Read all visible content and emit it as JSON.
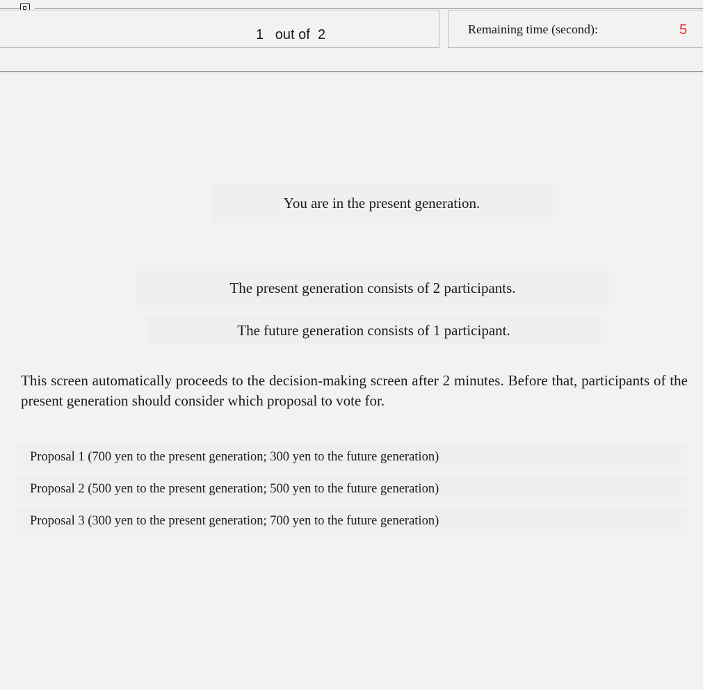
{
  "header": {
    "round": {
      "current": "1",
      "separator": "out of",
      "total": "2"
    },
    "timer": {
      "label": "Remaining time (second):",
      "value": "5",
      "value_color": "#ee2a2a"
    }
  },
  "main": {
    "generation_label": "You are in the present generation.",
    "present_generation_label": "The present generation consists of 2 participants.",
    "future_generation_label": "The future generation consists of 1 participant.",
    "instructions": "This screen automatically proceeds to the decision-making screen after 2 minutes. Before that, participants of the present generation should consider which proposal to vote for.",
    "proposals": [
      "Proposal 1 (700 yen to the present generation; 300 yen to the future generation)",
      "Proposal 2 (500 yen to the present generation; 500 yen to the future generation)",
      "Proposal 3 (300 yen to the present generation; 700 yen to the future generation)"
    ]
  }
}
